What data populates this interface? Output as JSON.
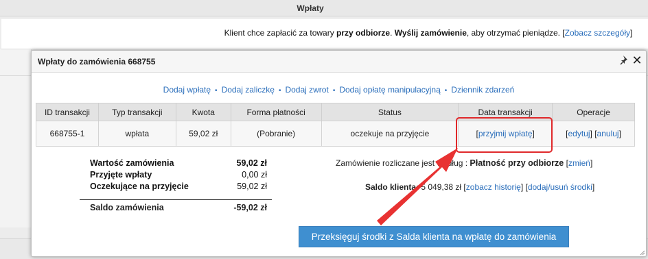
{
  "background": {
    "section_title": "Wpłaty",
    "notice": {
      "prefix": "Klient chce zapłacić za towary ",
      "bold1": "przy odbiorze",
      "middle": ". ",
      "bold2": "Wyślij zamówienie",
      "suffix": ", aby otrzymać pieniądze. [",
      "link": "Zobacz szczegóły",
      "close": "]"
    }
  },
  "dialog": {
    "title": "Wpłaty do zamówienia 668755",
    "icons": {
      "pin": "pin-icon",
      "close": "close-icon"
    },
    "action_links": [
      "Dodaj wpłatę",
      "Dodaj zaliczkę",
      "Dodaj zwrot",
      "Dodaj opłatę manipulacyjną",
      "Dziennik zdarzeń"
    ],
    "separator": "•",
    "table": {
      "headers": [
        "ID transakcji",
        "Typ transakcji",
        "Kwota",
        "Forma płatności",
        "Status",
        "Data transakcji",
        "Operacje"
      ],
      "row": {
        "id": "668755-1",
        "type": "wpłata",
        "amount": "59,02 zł",
        "payment_form": "(Pobranie)",
        "status": "oczekuje na przyjęcie",
        "accept_link": "przyjmij wpłatę",
        "edit_link": "edytuj",
        "cancel_link": "anuluj"
      }
    },
    "summary": {
      "rows": [
        {
          "label": "Wartość zamówienia",
          "value": "59,02 zł"
        },
        {
          "label": "Przyjęte wpłaty",
          "value": "0,00 zł"
        },
        {
          "label": "Oczekujące na przyjęcie",
          "value": "59,02 zł"
        }
      ],
      "balance_label": "Saldo zamówienia",
      "balance_value": "-59,02 zł"
    },
    "settlement": {
      "text": "Zamówienie rozliczane jest według : ",
      "method": "Płatność przy odbiorze",
      "change_link": "zmień"
    },
    "client_balance": {
      "label": "Saldo klienta:",
      "value": "5 049,38 zł",
      "history_link": "zobacz historię",
      "funds_link": "dodaj/usuń środki"
    },
    "transfer_button": "Przeksięguj środki z Salda klienta na wpłatę do zamówienia"
  },
  "colors": {
    "link": "#2a6ebb",
    "button": "#3f8fd0",
    "annotation": "#e0282a"
  }
}
